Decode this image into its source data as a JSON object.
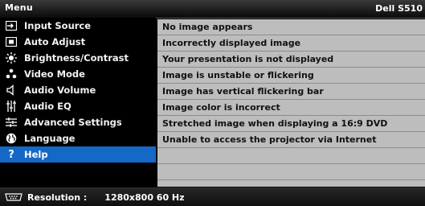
{
  "header": {
    "title": "Menu",
    "model": "Dell S510"
  },
  "menu": {
    "items": [
      {
        "label": "Input Source",
        "icon": "input-source-icon"
      },
      {
        "label": "Auto Adjust",
        "icon": "auto-adjust-icon"
      },
      {
        "label": "Brightness/Contrast",
        "icon": "brightness-icon"
      },
      {
        "label": "Video Mode",
        "icon": "video-mode-icon"
      },
      {
        "label": "Audio Volume",
        "icon": "speaker-icon"
      },
      {
        "label": "Audio EQ",
        "icon": "equalizer-icon"
      },
      {
        "label": "Advanced Settings",
        "icon": "sliders-icon"
      },
      {
        "label": "Language",
        "icon": "globe-icon"
      },
      {
        "label": "Help",
        "icon": "question-icon"
      }
    ],
    "selected": "Help"
  },
  "help": {
    "topics": [
      "No image appears",
      "Incorrectly displayed image",
      "Your presentation is not displayed",
      "Image is unstable or flickering",
      "Image has vertical flickering bar",
      "Image color is incorrect",
      "Stretched image when displaying a 16:9 DVD",
      "Unable to access the projector via Internet",
      "",
      ""
    ]
  },
  "footer": {
    "label": "Resolution :",
    "value": "1280x800 60 Hz",
    "icon": "vga-connector-icon"
  },
  "colors": {
    "selected": "#1469c7",
    "panel": "#bdbdbd",
    "background": "#000000"
  }
}
